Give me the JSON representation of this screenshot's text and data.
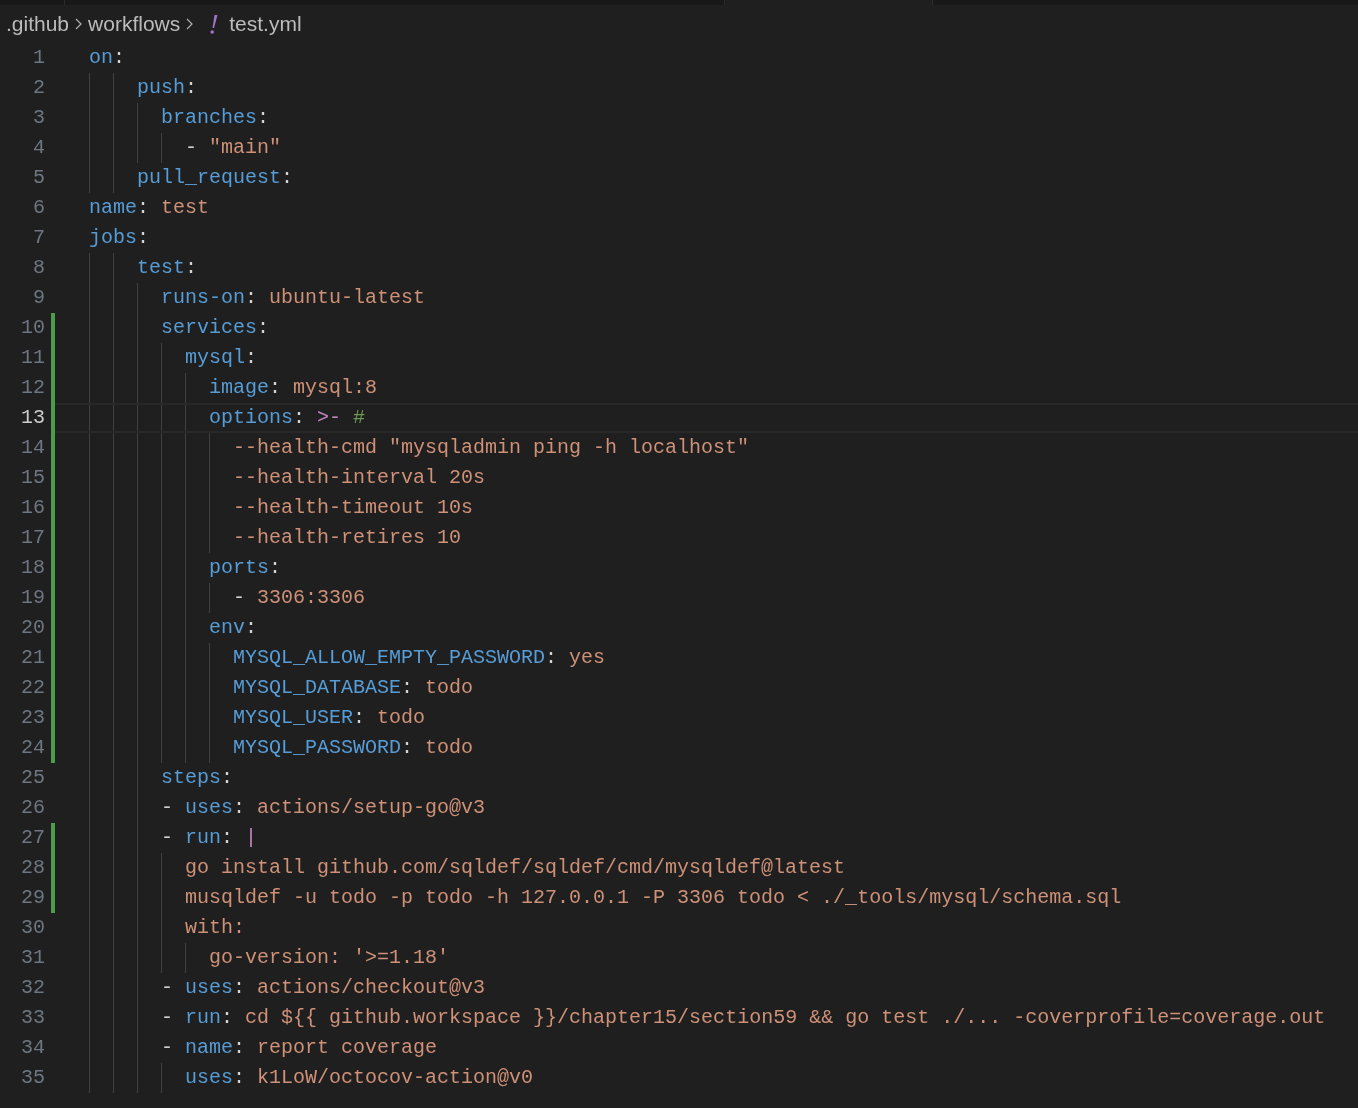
{
  "breadcrumbs": [
    {
      "kind": "folder",
      "label": ".github"
    },
    {
      "kind": "folder",
      "label": "workflows"
    },
    {
      "kind": "file",
      "label": "test.yml"
    }
  ],
  "editor": {
    "lines": [
      {
        "number": "1",
        "modified": false,
        "selected": false,
        "tokens": [
          {
            "kind": "key",
            "text": "on"
          },
          {
            "kind": "punct",
            "text": ":"
          }
        ]
      },
      {
        "number": "2",
        "modified": false,
        "selected": false,
        "tokens": [
          {
            "kind": "key",
            "text": "    push"
          },
          {
            "kind": "punct",
            "text": ":"
          }
        ]
      },
      {
        "number": "3",
        "modified": false,
        "selected": false,
        "tokens": [
          {
            "kind": "key",
            "text": "      branches"
          },
          {
            "kind": "punct",
            "text": ":"
          }
        ]
      },
      {
        "number": "4",
        "modified": false,
        "selected": false,
        "tokens": [
          {
            "kind": "punct",
            "text": "        - "
          },
          {
            "kind": "string",
            "text": "\"main\""
          }
        ]
      },
      {
        "number": "5",
        "modified": false,
        "selected": false,
        "tokens": [
          {
            "kind": "key",
            "text": "    pull_request"
          },
          {
            "kind": "punct",
            "text": ":"
          }
        ]
      },
      {
        "number": "6",
        "modified": false,
        "selected": false,
        "tokens": [
          {
            "kind": "key",
            "text": "name"
          },
          {
            "kind": "punct",
            "text": ": "
          },
          {
            "kind": "string",
            "text": "test"
          }
        ]
      },
      {
        "number": "7",
        "modified": false,
        "selected": false,
        "tokens": [
          {
            "kind": "key",
            "text": "jobs"
          },
          {
            "kind": "punct",
            "text": ":"
          }
        ]
      },
      {
        "number": "8",
        "modified": false,
        "selected": false,
        "tokens": [
          {
            "kind": "key",
            "text": "    test"
          },
          {
            "kind": "punct",
            "text": ":"
          }
        ]
      },
      {
        "number": "9",
        "modified": false,
        "selected": false,
        "tokens": [
          {
            "kind": "key",
            "text": "      runs-on"
          },
          {
            "kind": "punct",
            "text": ": "
          },
          {
            "kind": "string",
            "text": "ubuntu-latest"
          }
        ]
      },
      {
        "number": "10",
        "modified": true,
        "selected": false,
        "tokens": [
          {
            "kind": "key",
            "text": "      services"
          },
          {
            "kind": "punct",
            "text": ":"
          }
        ]
      },
      {
        "number": "11",
        "modified": true,
        "selected": false,
        "tokens": [
          {
            "kind": "key",
            "text": "        mysql"
          },
          {
            "kind": "punct",
            "text": ":"
          }
        ]
      },
      {
        "number": "12",
        "modified": true,
        "selected": false,
        "tokens": [
          {
            "kind": "key",
            "text": "          image"
          },
          {
            "kind": "punct",
            "text": ": "
          },
          {
            "kind": "string",
            "text": "mysql:8"
          }
        ]
      },
      {
        "number": "13",
        "modified": true,
        "selected": true,
        "tokens": [
          {
            "kind": "key",
            "text": "          options"
          },
          {
            "kind": "punct",
            "text": ": "
          },
          {
            "kind": "operator",
            "text": ">-"
          },
          {
            "kind": "comment",
            "text": " #"
          }
        ]
      },
      {
        "number": "14",
        "modified": true,
        "selected": false,
        "tokens": [
          {
            "kind": "string",
            "text": "            --health-cmd \"mysqladmin ping -h localhost\""
          }
        ]
      },
      {
        "number": "15",
        "modified": true,
        "selected": false,
        "tokens": [
          {
            "kind": "string",
            "text": "            --health-interval 20s"
          }
        ]
      },
      {
        "number": "16",
        "modified": true,
        "selected": false,
        "tokens": [
          {
            "kind": "string",
            "text": "            --health-timeout 10s"
          }
        ]
      },
      {
        "number": "17",
        "modified": true,
        "selected": false,
        "tokens": [
          {
            "kind": "string",
            "text": "            --health-retires 10"
          }
        ]
      },
      {
        "number": "18",
        "modified": true,
        "selected": false,
        "tokens": [
          {
            "kind": "key",
            "text": "          ports"
          },
          {
            "kind": "punct",
            "text": ":"
          }
        ]
      },
      {
        "number": "19",
        "modified": true,
        "selected": false,
        "tokens": [
          {
            "kind": "punct",
            "text": "            - "
          },
          {
            "kind": "string",
            "text": "3306:3306"
          }
        ]
      },
      {
        "number": "20",
        "modified": true,
        "selected": false,
        "tokens": [
          {
            "kind": "key",
            "text": "          env"
          },
          {
            "kind": "punct",
            "text": ":"
          }
        ]
      },
      {
        "number": "21",
        "modified": true,
        "selected": false,
        "tokens": [
          {
            "kind": "key",
            "text": "            MYSQL_ALLOW_EMPTY_PASSWORD"
          },
          {
            "kind": "punct",
            "text": ": "
          },
          {
            "kind": "string",
            "text": "yes"
          }
        ]
      },
      {
        "number": "22",
        "modified": true,
        "selected": false,
        "tokens": [
          {
            "kind": "key",
            "text": "            MYSQL_DATABASE"
          },
          {
            "kind": "punct",
            "text": ": "
          },
          {
            "kind": "string",
            "text": "todo"
          }
        ]
      },
      {
        "number": "23",
        "modified": true,
        "selected": false,
        "tokens": [
          {
            "kind": "key",
            "text": "            MYSQL_USER"
          },
          {
            "kind": "punct",
            "text": ": "
          },
          {
            "kind": "string",
            "text": "todo"
          }
        ]
      },
      {
        "number": "24",
        "modified": true,
        "selected": false,
        "tokens": [
          {
            "kind": "key",
            "text": "            MYSQL_PASSWORD"
          },
          {
            "kind": "punct",
            "text": ": "
          },
          {
            "kind": "string",
            "text": "todo"
          }
        ]
      },
      {
        "number": "25",
        "modified": false,
        "selected": false,
        "tokens": [
          {
            "kind": "key",
            "text": "      steps"
          },
          {
            "kind": "punct",
            "text": ":"
          }
        ]
      },
      {
        "number": "26",
        "modified": false,
        "selected": false,
        "tokens": [
          {
            "kind": "punct",
            "text": "      - "
          },
          {
            "kind": "key",
            "text": "uses"
          },
          {
            "kind": "punct",
            "text": ": "
          },
          {
            "kind": "string",
            "text": "actions/setup-go@v3"
          }
        ]
      },
      {
        "number": "27",
        "modified": true,
        "selected": false,
        "tokens": [
          {
            "kind": "punct",
            "text": "      - "
          },
          {
            "kind": "key",
            "text": "run"
          },
          {
            "kind": "punct",
            "text": ": "
          },
          {
            "kind": "operator",
            "text": "|"
          }
        ]
      },
      {
        "number": "28",
        "modified": true,
        "selected": false,
        "tokens": [
          {
            "kind": "string",
            "text": "        go install github.com/sqldef/sqldef/cmd/mysqldef@latest"
          }
        ]
      },
      {
        "number": "29",
        "modified": true,
        "selected": false,
        "tokens": [
          {
            "kind": "string",
            "text": "        musqldef -u todo -p todo -h 127.0.0.1 -P 3306 todo < ./_tools/mysql/schema.sql"
          }
        ]
      },
      {
        "number": "30",
        "modified": false,
        "selected": false,
        "tokens": [
          {
            "kind": "string",
            "text": "        with:"
          }
        ]
      },
      {
        "number": "31",
        "modified": false,
        "selected": false,
        "tokens": [
          {
            "kind": "string",
            "text": "          go-version: '>=1.18'"
          }
        ]
      },
      {
        "number": "32",
        "modified": false,
        "selected": false,
        "tokens": [
          {
            "kind": "punct",
            "text": "      - "
          },
          {
            "kind": "key",
            "text": "uses"
          },
          {
            "kind": "punct",
            "text": ": "
          },
          {
            "kind": "string",
            "text": "actions/checkout@v3"
          }
        ]
      },
      {
        "number": "33",
        "modified": false,
        "selected": false,
        "tokens": [
          {
            "kind": "punct",
            "text": "      - "
          },
          {
            "kind": "key",
            "text": "run"
          },
          {
            "kind": "punct",
            "text": ": "
          },
          {
            "kind": "string",
            "text": "cd ${{ github.workspace }}/chapter15/section59 && go test ./... -coverprofile=coverage.out"
          }
        ]
      },
      {
        "number": "34",
        "modified": false,
        "selected": false,
        "tokens": [
          {
            "kind": "punct",
            "text": "      - "
          },
          {
            "kind": "key",
            "text": "name"
          },
          {
            "kind": "punct",
            "text": ": "
          },
          {
            "kind": "string",
            "text": "report coverage"
          }
        ]
      },
      {
        "number": "35",
        "modified": false,
        "selected": false,
        "tokens": [
          {
            "kind": "key",
            "text": "        uses"
          },
          {
            "kind": "punct",
            "text": ": "
          },
          {
            "kind": "string",
            "text": "k1LoW/octocov-action@v0"
          }
        ]
      }
    ]
  }
}
